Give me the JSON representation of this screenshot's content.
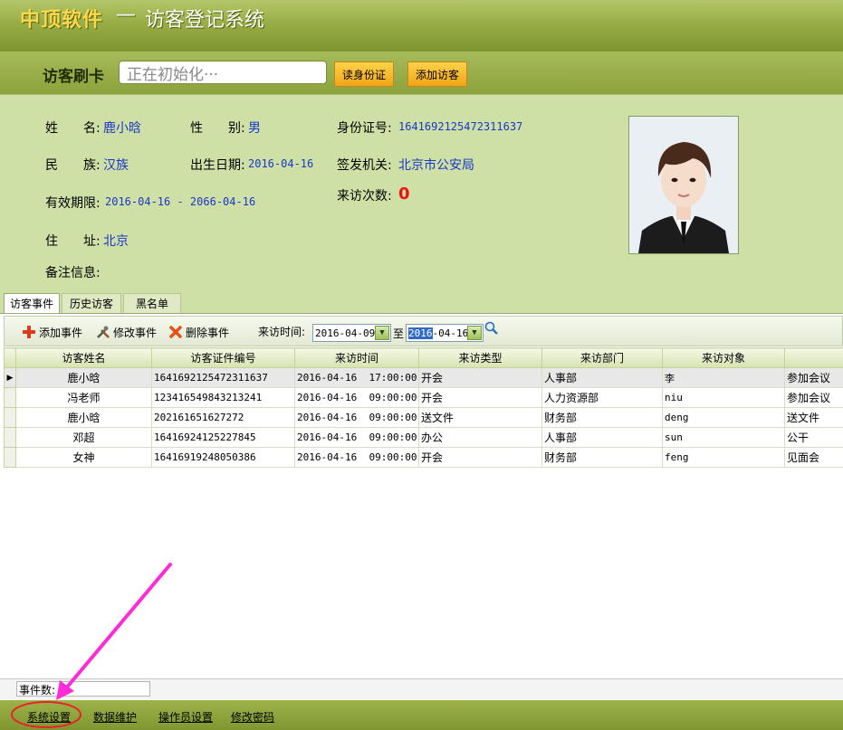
{
  "title": {
    "brand": "中顶软件",
    "dash": "—",
    "system": "访客登记系统"
  },
  "cardbar": {
    "label": "访客刷卡",
    "input_value": "正在初始化···",
    "read_id_label": "读身份证",
    "add_visitor_label": "添加访客"
  },
  "visitor": {
    "name_label": "姓　　名:",
    "name": "鹿小晗",
    "gender_label": "性　　别:",
    "gender": "男",
    "id_label": "身份证号:",
    "id": "1641692125472311637",
    "ethnicity_label": "民　　族:",
    "ethnicity": "汉族",
    "birth_label": "出生日期:",
    "birth": "2016-04-16",
    "issuer_label": "签发机关:",
    "issuer": "北京市公安局",
    "validity_label": "有效期限:",
    "validity": "2016-04-16 - 2066-04-16",
    "visits_label": "来访次数:",
    "visits": "0",
    "address_label": "住　　址:",
    "address": "北京",
    "note_label": "备注信息:"
  },
  "tabs": [
    "访客事件",
    "历史访客",
    "黑名单"
  ],
  "toolbar": {
    "add_label": "添加事件",
    "edit_label": "修改事件",
    "delete_label": "删除事件",
    "time_label": "来访时间:",
    "date_from": "2016-04-09",
    "to_label": "至",
    "date_to_highlight": "2016",
    "date_to_rest": "-04-16"
  },
  "grid": {
    "columns": [
      "访客姓名",
      "访客证件编号",
      "来访时间",
      "来访类型",
      "来访部门",
      "来访对象",
      ""
    ],
    "rows": [
      [
        "鹿小晗",
        "1641692125472311637",
        "2016-04-16  17:00:00",
        "开会",
        "人事部",
        "李",
        "参加会议"
      ],
      [
        "冯老师",
        "123416549843213241",
        "2016-04-16  09:00:00",
        "开会",
        "人力资源部",
        "niu",
        "参加会议"
      ],
      [
        "鹿小晗",
        "202161651627272",
        "2016-04-16  09:00:00",
        "送文件",
        "财务部",
        "deng",
        "送文件"
      ],
      [
        "邓超",
        "16416924125227845",
        "2016-04-16  09:00:00",
        "办公",
        "人事部",
        "sun",
        "公干"
      ],
      [
        "女神",
        "16416919248050386",
        "2016-04-16  09:00:00",
        "开会",
        "财务部",
        "feng",
        "见面会"
      ]
    ]
  },
  "status": {
    "count_label": "事件数:"
  },
  "nav": [
    "系统设置",
    "数据维护",
    "操作员设置",
    "修改密码"
  ],
  "colors": {
    "accent_green": "#8ca23b",
    "link_blue": "#1a37c8",
    "alert_red": "#e11111",
    "annotation_magenta": "#ff2bd6"
  }
}
